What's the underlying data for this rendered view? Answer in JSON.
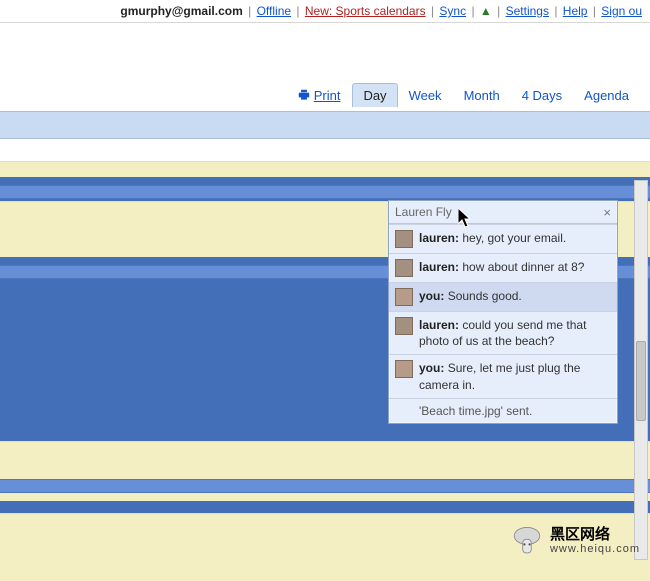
{
  "topbar": {
    "email": "gmurphy@gmail.com",
    "offline": "Offline",
    "promo": "New: Sports calendars",
    "sync": "Sync",
    "settings": "Settings",
    "help": "Help",
    "signout": "Sign ou"
  },
  "tabs": {
    "print": "Print",
    "items": [
      "Day",
      "Week",
      "Month",
      "4 Days",
      "Agenda"
    ],
    "active_index": 0
  },
  "chat": {
    "title": "Lauren Fly",
    "close": "×",
    "messages": [
      {
        "sender": "lauren:",
        "text": "hey, got your email.",
        "avatar": "lauren"
      },
      {
        "sender": "lauren:",
        "text": "how about dinner at 8?",
        "avatar": "lauren"
      },
      {
        "sender": "you:",
        "text": "Sounds good.",
        "avatar": "you",
        "shade": true
      },
      {
        "sender": "lauren:",
        "text": "could you send me that photo of us at the beach?",
        "avatar": "lauren"
      },
      {
        "sender": "you:",
        "text": "Sure, let me just plug the camera in.",
        "avatar": "you"
      }
    ],
    "system": "'Beach time.jpg' sent."
  },
  "watermark": {
    "line1": "黑区网络",
    "line2": "www.heiqu.com"
  }
}
